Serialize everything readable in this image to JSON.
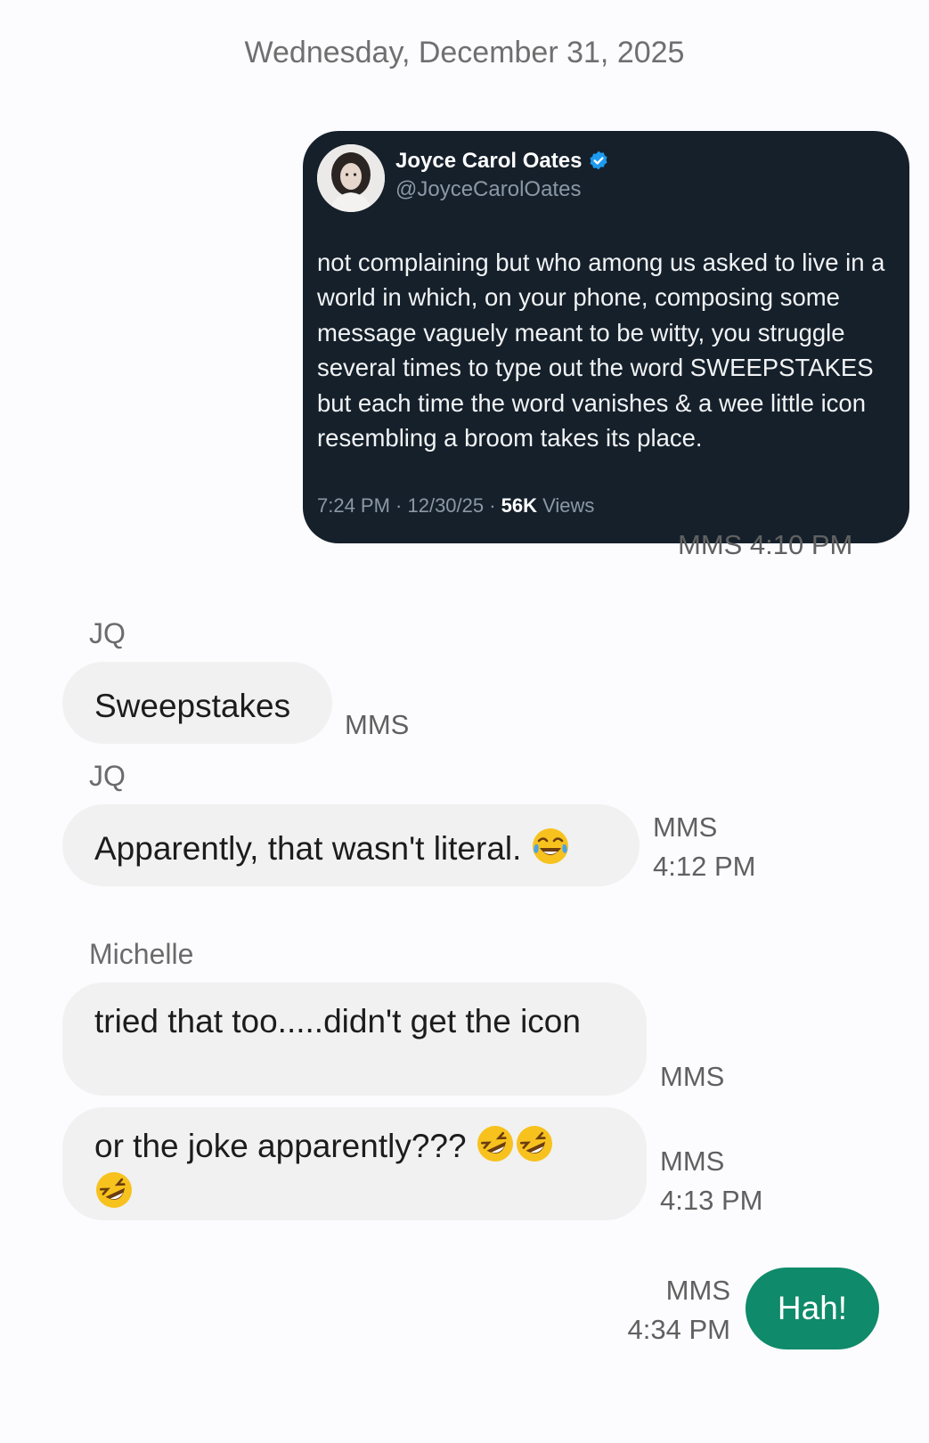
{
  "date_header": "Wednesday, December 31, 2025",
  "tweet": {
    "author_name": "Joyce Carol Oates",
    "author_handle": "@JoyceCarolOates",
    "text": "not complaining but who among us asked to live in a world in which, on your phone, composing some message vaguely meant to be witty, you struggle several times to type out the word SWEEPSTAKES but each time the word vanishes & a wee little icon resembling a broom takes its place.",
    "time": "7:24 PM · 12/30/25 · ",
    "views_count": "56K",
    "views_label": " Views",
    "verified_color": "#1d9bf0",
    "status": "MMS 4:10 PM"
  },
  "messages": [
    {
      "sender": "JQ",
      "text": "Sweepstakes",
      "status_line1": "MMS",
      "status_line2": ""
    },
    {
      "sender": "JQ",
      "text": "Apparently, that wasn't literal.",
      "emoji": "face-with-tears-of-joy",
      "status_line1": "MMS",
      "status_line2": "4:12 PM"
    },
    {
      "sender": "Michelle",
      "text": "tried that too.....didn't get the icon",
      "status_line1": "MMS",
      "status_line2": ""
    },
    {
      "sender": "",
      "text": "or the joke apparently???",
      "emoji": "rolling-on-the-floor-laughing x3",
      "status_line1": "MMS",
      "status_line2": "4:13 PM"
    }
  ],
  "outgoing": {
    "text": "Hah!",
    "status_line1": "MMS",
    "status_line2": "4:34 PM",
    "color": "#0f8a6a"
  }
}
